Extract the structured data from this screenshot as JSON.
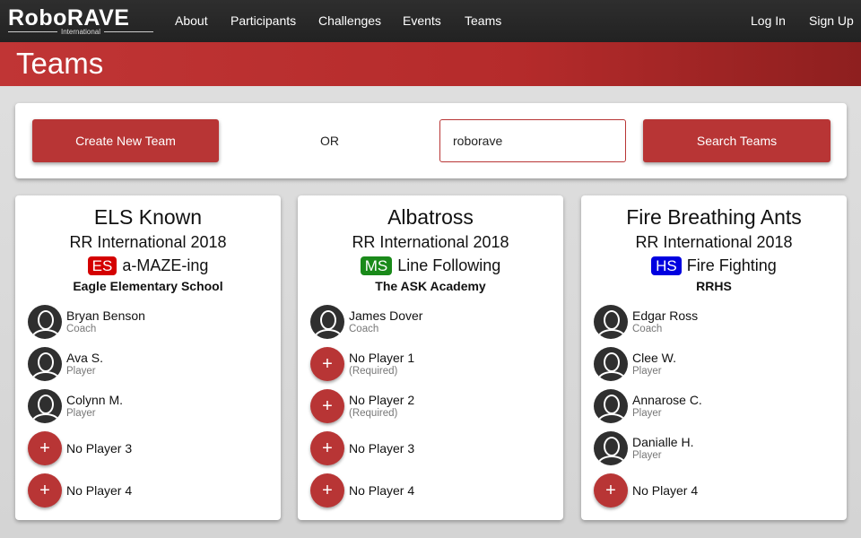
{
  "nav": {
    "logo": "RoboRAVE",
    "logo_sub": "International",
    "links": [
      "About",
      "Participants",
      "Challenges",
      "Events",
      "Teams"
    ],
    "login": "Log In",
    "signup": "Sign Up"
  },
  "banner": {
    "title": "Teams"
  },
  "search": {
    "create_label": "Create New Team",
    "or": "OR",
    "value": "roborave",
    "search_label": "Search Teams"
  },
  "colors": {
    "accent": "#b83535",
    "ES": "#d40000",
    "MS": "#1a8a1a",
    "HS": "#0000e0"
  },
  "teams": [
    {
      "name": "ELS Known",
      "event": "RR International 2018",
      "division": "ES",
      "challenge": "a-MAZE-ing",
      "school": "Eagle Elementary School",
      "members": [
        {
          "name": "Bryan Benson",
          "role": "Coach",
          "icon": "user-icon"
        },
        {
          "name": "Ava S.",
          "role": "Player",
          "icon": "user-icon"
        },
        {
          "name": "Colynn M.",
          "role": "Player",
          "icon": "user-icon"
        },
        {
          "name": "No Player 3",
          "role": "",
          "icon": "plus-icon"
        },
        {
          "name": "No Player 4",
          "role": "",
          "icon": "plus-icon"
        }
      ]
    },
    {
      "name": "Albatross",
      "event": "RR International 2018",
      "division": "MS",
      "challenge": "Line Following",
      "school": "The ASK Academy",
      "members": [
        {
          "name": "James Dover",
          "role": "Coach",
          "icon": "user-icon"
        },
        {
          "name": "No Player 1",
          "role": "(Required)",
          "icon": "plus-icon"
        },
        {
          "name": "No Player 2",
          "role": "(Required)",
          "icon": "plus-icon"
        },
        {
          "name": "No Player 3",
          "role": "",
          "icon": "plus-icon"
        },
        {
          "name": "No Player 4",
          "role": "",
          "icon": "plus-icon"
        }
      ]
    },
    {
      "name": "Fire Breathing Ants",
      "event": "RR International 2018",
      "division": "HS",
      "challenge": "Fire Fighting",
      "school": "RRHS",
      "members": [
        {
          "name": "Edgar Ross",
          "role": "Coach",
          "icon": "user-icon"
        },
        {
          "name": "Clee W.",
          "role": "Player",
          "icon": "user-icon"
        },
        {
          "name": "Annarose C.",
          "role": "Player",
          "icon": "user-icon"
        },
        {
          "name": "Danialle H.",
          "role": "Player",
          "icon": "user-icon"
        },
        {
          "name": "No Player 4",
          "role": "",
          "icon": "plus-icon"
        }
      ]
    }
  ]
}
